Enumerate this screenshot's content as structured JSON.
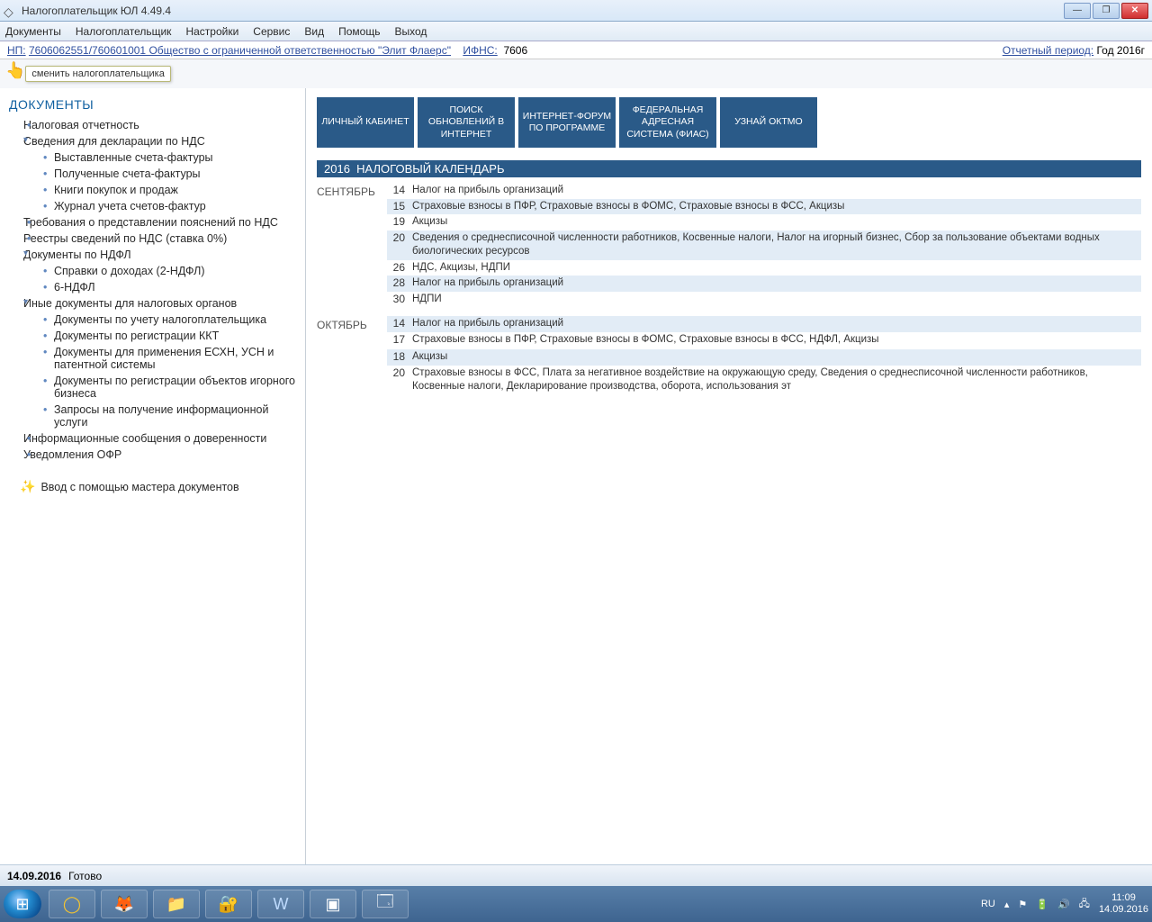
{
  "window": {
    "title": "Налогоплательщик ЮЛ 4.49.4"
  },
  "menu": [
    "Документы",
    "Налогоплательщик",
    "Настройки",
    "Сервис",
    "Вид",
    "Помощь",
    "Выход"
  ],
  "info": {
    "np_label": "НП:",
    "np_value": "7606062551/760601001 Общество с ограниченной ответственностью \"Элит Флаерс\"",
    "ifns_label": "ИФНС:",
    "ifns_value": "7606",
    "period_label": "Отчетный период:",
    "period_value": "Год  2016г"
  },
  "tooltip": "сменить налогоплательщика",
  "sidebar": {
    "heading": "ДОКУМЕНТЫ",
    "tree": [
      {
        "lvl": 0,
        "type": "bullet",
        "label": "Налоговая отчетность"
      },
      {
        "lvl": 0,
        "type": "open",
        "label": "Сведения для декларации по НДС"
      },
      {
        "lvl": 2,
        "type": "bullet",
        "label": "Выставленные счета-фактуры"
      },
      {
        "lvl": 2,
        "type": "bullet",
        "label": "Полученные счета-фактуры"
      },
      {
        "lvl": 2,
        "type": "bullet",
        "label": "Книги покупок и продаж"
      },
      {
        "lvl": 2,
        "type": "bullet",
        "label": "Журнал учета счетов-фактур"
      },
      {
        "lvl": 0,
        "type": "bullet",
        "label": "Требования о представлении пояснений по НДС"
      },
      {
        "lvl": 0,
        "type": "bullet",
        "label": "Реестры сведений по НДС (ставка 0%)"
      },
      {
        "lvl": 0,
        "type": "open",
        "label": "Документы по НДФЛ"
      },
      {
        "lvl": 2,
        "type": "bullet",
        "label": "Справки о доходах (2-НДФЛ)"
      },
      {
        "lvl": 2,
        "type": "bullet",
        "label": "6-НДФЛ"
      },
      {
        "lvl": 0,
        "type": "open",
        "label": "Иные документы для налоговых органов"
      },
      {
        "lvl": 2,
        "type": "bullet",
        "label": "Документы по учету налогоплательщика"
      },
      {
        "lvl": 2,
        "type": "bullet",
        "label": "Документы по регистрации ККТ"
      },
      {
        "lvl": 2,
        "type": "bullet",
        "label": "Документы для применения ЕСХН, УСН и патентной системы"
      },
      {
        "lvl": 2,
        "type": "bullet",
        "label": "Документы по регистрации объектов игорного бизнеса"
      },
      {
        "lvl": 2,
        "type": "bullet",
        "label": "Запросы на получение информационной услуги"
      },
      {
        "lvl": 0,
        "type": "bullet",
        "label": "Информационные сообщения о доверенности"
      },
      {
        "lvl": 0,
        "type": "bullet",
        "label": "Уведомления ОФР"
      }
    ],
    "wizard": "Ввод с помощью мастера документов"
  },
  "cards": [
    "ЛИЧНЫЙ КАБИНЕТ",
    "ПОИСК ОБНОВЛЕНИЙ В ИНТЕРНЕТ",
    "ИНТЕРНЕТ-ФОРУМ ПО ПРОГРАММЕ",
    "ФЕДЕРАЛЬНАЯ АДРЕСНАЯ СИСТЕМА (ФИАС)",
    "УЗНАЙ ОКТМО"
  ],
  "calendar": {
    "year": "2016",
    "title": "НАЛОГОВЫЙ КАЛЕНДАРЬ",
    "months": [
      {
        "name": "СЕНТЯБРЬ",
        "days": [
          {
            "d": "14",
            "hl": false,
            "t": "Налог на прибыль организаций"
          },
          {
            "d": "15",
            "hl": true,
            "t": "Страховые взносы в ПФР, Страховые взносы в ФОМС, Страховые взносы в ФСС, Акцизы"
          },
          {
            "d": "19",
            "hl": false,
            "t": "Акцизы"
          },
          {
            "d": "20",
            "hl": true,
            "t": "Сведения о среднесписочной численности работников, Косвенные налоги, Налог на игорный бизнес, Сбор за пользование объектами водных биологических ресурсов"
          },
          {
            "d": "26",
            "hl": false,
            "t": "НДС, Акцизы, НДПИ"
          },
          {
            "d": "28",
            "hl": true,
            "t": "Налог на прибыль организаций"
          },
          {
            "d": "30",
            "hl": false,
            "t": "НДПИ"
          }
        ]
      },
      {
        "name": "ОКТЯБРЬ",
        "days": [
          {
            "d": "14",
            "hl": true,
            "t": "Налог на прибыль организаций"
          },
          {
            "d": "17",
            "hl": false,
            "t": "Страховые взносы в ПФР, Страховые взносы в ФОМС, Страховые взносы в ФСС, НДФЛ, Акцизы"
          },
          {
            "d": "",
            "hl": false,
            "t": ""
          },
          {
            "d": "18",
            "hl": true,
            "t": "Акцизы"
          },
          {
            "d": "20",
            "hl": false,
            "t": "Страховые взносы в ФСС, Плата за негативное воздействие на окружающую среду, Сведения о среднесписочной численности работников, Косвенные налоги, Декларирование производства, оборота, использования эт"
          }
        ]
      }
    ]
  },
  "status": {
    "date": "14.09.2016",
    "msg": "Готово"
  },
  "tray": {
    "lang": "RU",
    "time": "11:09",
    "date": "14.09.2016"
  }
}
